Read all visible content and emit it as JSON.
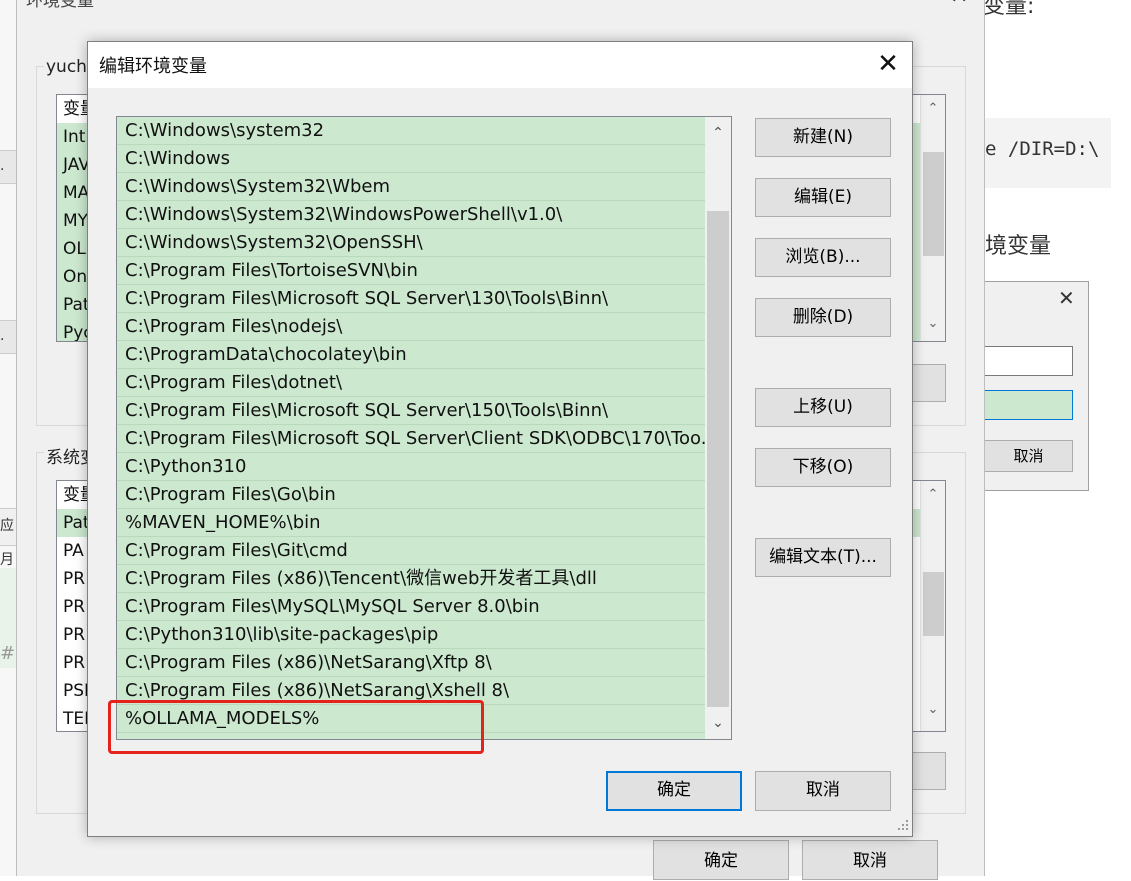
{
  "background_page": {
    "top_text": "变量:",
    "code_text": "e /DIR=D:\\",
    "heading": "境变量"
  },
  "env_window": {
    "title": "环境变量",
    "user_group_label": "yuch",
    "user_list": {
      "header": "变量",
      "rows": [
        "Int",
        "JAV",
        "MA",
        "MY",
        "OL",
        "On",
        "Pat",
        "Pyc"
      ]
    },
    "sys_group_label": "系统变",
    "sys_list": {
      "header": "变量",
      "rows": [
        "Pat",
        "PA",
        "PR",
        "PR",
        "PR",
        "PR",
        "PSI",
        "TEI"
      ]
    },
    "ok_button": "确定",
    "cancel_button": "取消"
  },
  "left_strip": {
    "items": [
      ".",
      ".",
      "应月",
      "#p"
    ]
  },
  "small_dialog": {
    "cancel_button": "取消"
  },
  "dialog": {
    "title": "编辑环境变量",
    "paths": [
      "C:\\Windows\\system32",
      "C:\\Windows",
      "C:\\Windows\\System32\\Wbem",
      "C:\\Windows\\System32\\WindowsPowerShell\\v1.0\\",
      "C:\\Windows\\System32\\OpenSSH\\",
      "C:\\Program Files\\TortoiseSVN\\bin",
      "C:\\Program Files\\Microsoft SQL Server\\130\\Tools\\Binn\\",
      "C:\\Program Files\\nodejs\\",
      "C:\\ProgramData\\chocolatey\\bin",
      "C:\\Program Files\\dotnet\\",
      "C:\\Program Files\\Microsoft SQL Server\\150\\Tools\\Binn\\",
      "C:\\Program Files\\Microsoft SQL Server\\Client SDK\\ODBC\\170\\Too...",
      "C:\\Python310",
      "C:\\Program Files\\Go\\bin",
      "%MAVEN_HOME%\\bin",
      "C:\\Program Files\\Git\\cmd",
      "C:\\Program Files (x86)\\Tencent\\微信web开发者工具\\dll",
      "C:\\Program Files\\MySQL\\MySQL Server 8.0\\bin",
      "C:\\Python310\\lib\\site-packages\\pip",
      "C:\\Program Files (x86)\\NetSarang\\Xftp 8\\",
      "C:\\Program Files (x86)\\NetSarang\\Xshell 8\\",
      "%OLLAMA_MODELS%"
    ],
    "buttons": {
      "new": "新建(N)",
      "edit": "编辑(E)",
      "browse": "浏览(B)...",
      "delete": "删除(D)",
      "move_up": "上移(U)",
      "move_down": "下移(O)",
      "edit_text": "编辑文本(T)...",
      "ok": "确定",
      "cancel": "取消"
    }
  }
}
